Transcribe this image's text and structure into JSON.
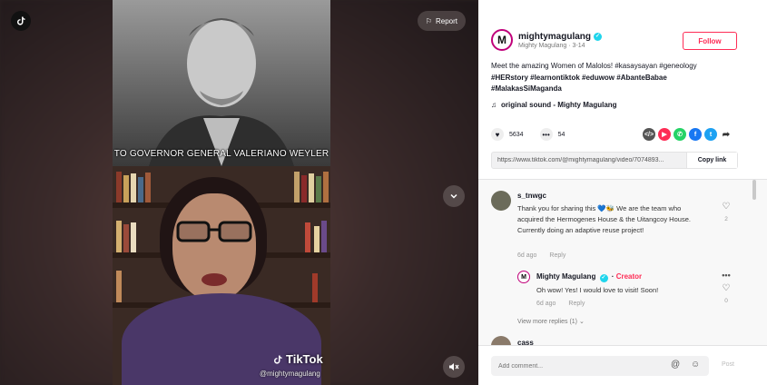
{
  "video": {
    "report_label": "Report",
    "caption": "TO GOVERNOR GENERAL VALERIANO WEYLER",
    "watermark": "TikTok",
    "watermark_handle": "@mightymagulang"
  },
  "author": {
    "username": "mightymagulang",
    "display": "Mighty Magulang · 3-14",
    "avatar_letter": "M",
    "follow_label": "Follow"
  },
  "description": {
    "line1": "Meet the amazing Women of Malolos! #kasaysayan #geneology",
    "line2": "#HERstory #learnontiktok #eduwow #AbanteBabae",
    "line3": "#MalakasSiMaganda",
    "music": "original sound - Mighty Magulang"
  },
  "stats": {
    "likes": "5634",
    "comments": "54"
  },
  "link": {
    "url": "https://www.tiktok.com/@mightymagulang/video/7074893...",
    "copy_label": "Copy link"
  },
  "comments": [
    {
      "name": "s_tnwgc",
      "text": "Thank you for sharing this 💙🐝 We are the team who acquired the Hermogenes House & the Uitangcoy House. Currently doing an adaptive reuse project!",
      "age": "6d ago",
      "reply": "Reply",
      "likes": "2"
    },
    {
      "name": "Mighty Magulang",
      "tag": "Creator",
      "text": "Oh wow! Yes! I would love to visit! Soon!",
      "age": "6d ago",
      "reply": "Reply",
      "likes": "0"
    }
  ],
  "view_more": "View more replies (1) ⌄",
  "next_comment_name": "cass",
  "input": {
    "placeholder": "Add comment...",
    "post_label": "Post"
  },
  "colors": {
    "accent": "#fe2c55",
    "verified": "#20d5ec"
  }
}
